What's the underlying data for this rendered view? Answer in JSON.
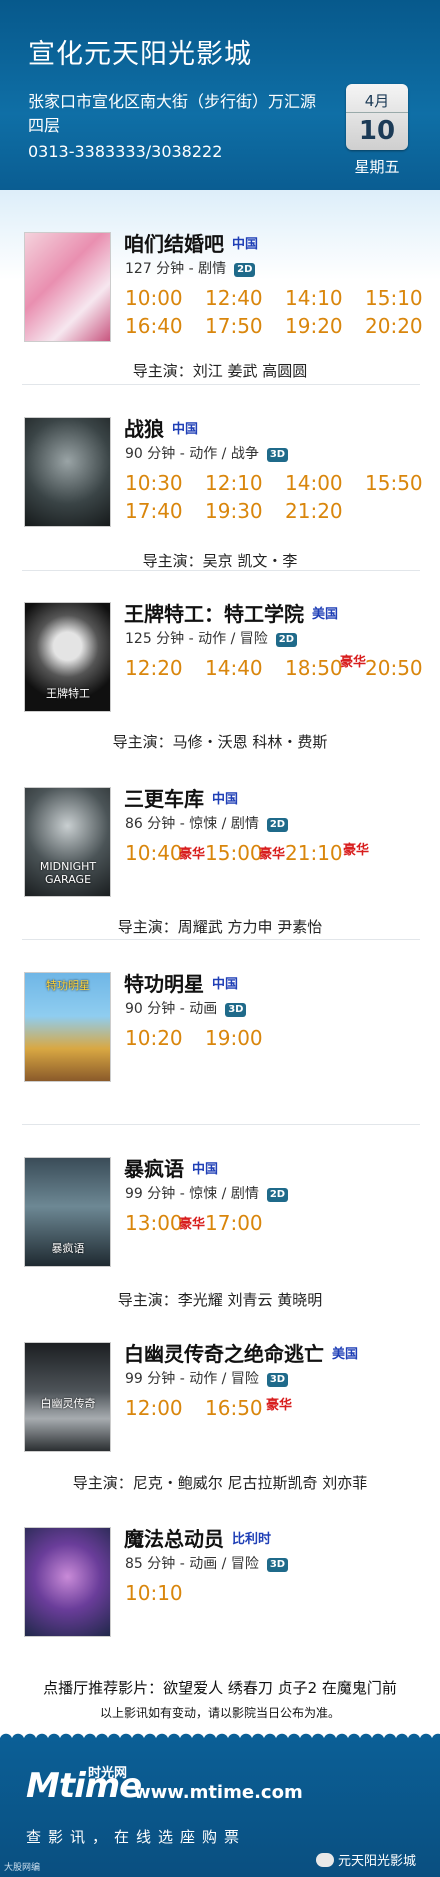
{
  "header": {
    "cinema_name": "宣化元天阳光影城",
    "address": "张家口市宣化区南大街（步行街）万汇源四层",
    "phone": "0313-3383333/3038222",
    "month": "4月",
    "day": "10",
    "weekday": "星期五"
  },
  "colors": {
    "header_blue": "#0a5d92",
    "time_orange": "#d9860c",
    "country_blue": "#1f3fb6",
    "tag_red": "#d81e1e"
  },
  "movies": [
    {
      "title": "咱们结婚吧",
      "country": "中国",
      "duration": "127 分钟 - 剧情",
      "format": "2D",
      "times": [
        "10:00",
        "12:40",
        "14:10",
        "15:10",
        "16:40",
        "17:50",
        "19:20",
        "20:20"
      ],
      "cast": "导主演：刘江  姜武  高圆圆"
    },
    {
      "title": "战狼",
      "country": "中国",
      "duration": "90 分钟 - 动作 / 战争",
      "format": "3D",
      "times": [
        "10:30",
        "12:10",
        "14:00",
        "15:50",
        "17:40",
        "19:30",
        "21:20"
      ],
      "cast": "导主演：吴京  凯文・李"
    },
    {
      "title": "王牌特工：特工学院",
      "country": "美国",
      "duration": "125 分钟 - 动作 / 冒险",
      "format": "2D",
      "times": [
        "12:20",
        "14:40",
        "18:50",
        "20:50"
      ],
      "tags": [
        "豪华"
      ],
      "cast": "导主演：马修・沃恩  科林・费斯",
      "poster_text": "王牌特工"
    },
    {
      "title": "三更车库",
      "country": "中国",
      "duration": "86 分钟 - 惊悚 / 剧情",
      "format": "2D",
      "times": [
        "10:40",
        "15:00",
        "21:10"
      ],
      "tags": [
        "豪华",
        "豪华",
        "豪华"
      ],
      "cast": "导主演：周耀武  方力申  尹素怡",
      "poster_text": "MIDNIGHT GARAGE"
    },
    {
      "title": "特功明星",
      "country": "中国",
      "duration": "90 分钟 - 动画",
      "format": "3D",
      "times": [
        "10:20",
        "19:00"
      ],
      "poster_text": "特功明星"
    },
    {
      "title": "暴疯语",
      "country": "中国",
      "duration": "99 分钟 - 惊悚 / 剧情",
      "format": "2D",
      "times": [
        "13:00",
        "17:00"
      ],
      "tags": [
        "豪华"
      ],
      "cast": "导主演：李光耀  刘青云  黄晓明",
      "poster_text": "暴疯语"
    },
    {
      "title": "白幽灵传奇之绝命逃亡",
      "country": "美国",
      "duration": "99 分钟 - 动作 / 冒险",
      "format": "3D",
      "times": [
        "12:00",
        "16:50"
      ],
      "tags": [
        "豪华"
      ],
      "cast": "导主演：尼克・鲍威尔  尼古拉斯凯奇  刘亦菲",
      "poster_text": "白幽灵传奇"
    },
    {
      "title": "魔法总动员",
      "country": "比利时",
      "duration": "85 分钟 - 动画 / 冒险",
      "format": "3D",
      "times": [
        "10:10"
      ]
    }
  ],
  "recommend": "点播厅推荐影片：欲望爱人  绣春刀  贞子2  在魔鬼门前",
  "notice": "以上影讯如有变动，请以影院当日公布为准。",
  "footer": {
    "logo": "Mtime",
    "logo_sub": "时光网",
    "site": "www.mtime.com",
    "slogan": "查影讯，在线选座购票",
    "wechat": "元天阳光影城",
    "corner": "大股网编"
  }
}
